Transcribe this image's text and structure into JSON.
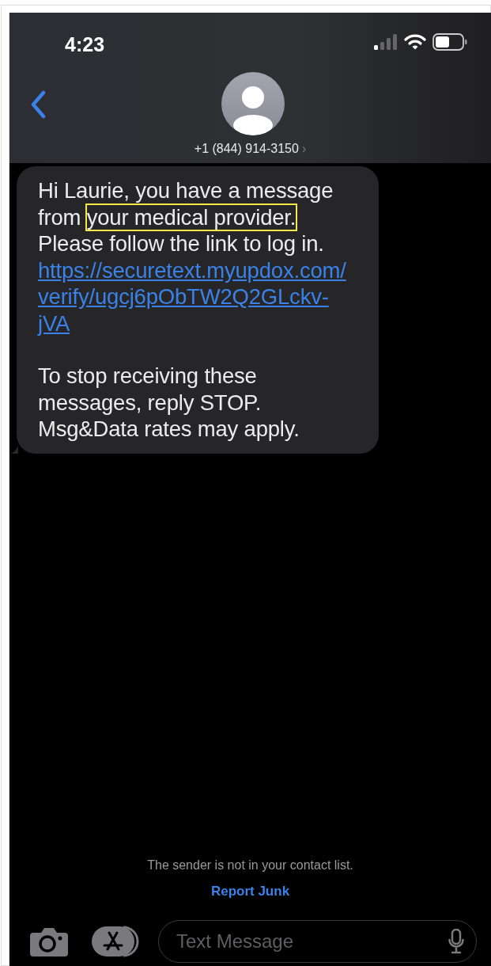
{
  "status_bar": {
    "time": "4:23"
  },
  "header": {
    "contact": "+1 (844) 914-3150",
    "chevron": "›"
  },
  "message": {
    "segments": [
      {
        "kind": "plain",
        "text": "Hi Laurie, you have a message from "
      },
      {
        "kind": "highlight",
        "text": "your medical provider."
      },
      {
        "kind": "plain",
        "text": " Please follow the link to log in."
      }
    ],
    "link": "https://securetext.myupdox.com/verify/ugcj6pObTW2Q2GLckv-jVA",
    "footer": "To stop receiving these messages, reply STOP. Msg&Data rates may apply."
  },
  "notice": "The sender is not in your contact list.",
  "report_link": "Report Junk",
  "composer": {
    "placeholder": "Text Message"
  }
}
